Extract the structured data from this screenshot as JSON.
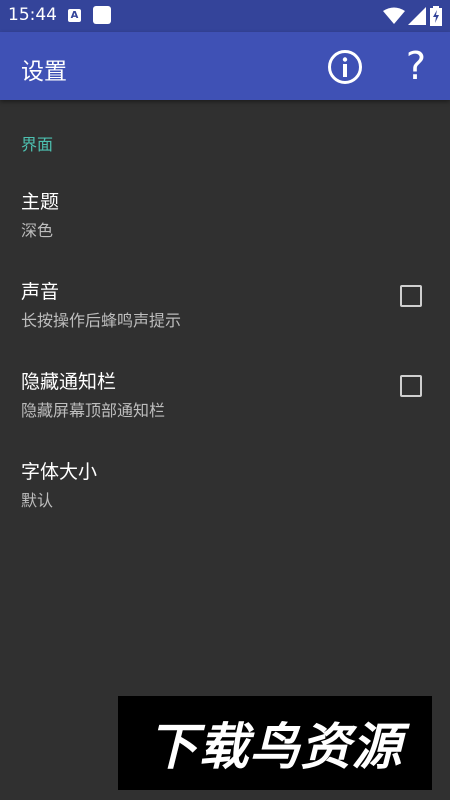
{
  "status_bar": {
    "time": "15:44",
    "notification_letter": "A",
    "icons": [
      "notification-a-icon",
      "notification-square-icon",
      "wifi-icon",
      "cell-signal-icon",
      "battery-icon"
    ]
  },
  "app_bar": {
    "title": "设置",
    "info_icon": "info-icon",
    "help_label": "?"
  },
  "section": {
    "header": "界面"
  },
  "preferences": [
    {
      "title": "主题",
      "summary": "深色",
      "has_checkbox": false
    },
    {
      "title": "声音",
      "summary": "长按操作后蜂鸣声提示",
      "has_checkbox": true,
      "checked": false
    },
    {
      "title": "隐藏通知栏",
      "summary": "隐藏屏幕顶部通知栏",
      "has_checkbox": true,
      "checked": false
    },
    {
      "title": "字体大小",
      "summary": "默认",
      "has_checkbox": false
    }
  ],
  "watermark": "下载鸟资源",
  "colors": {
    "status_bar": "#34449a",
    "app_bar": "#3f51b5",
    "background": "#303030",
    "accent": "#4dc0b0"
  }
}
